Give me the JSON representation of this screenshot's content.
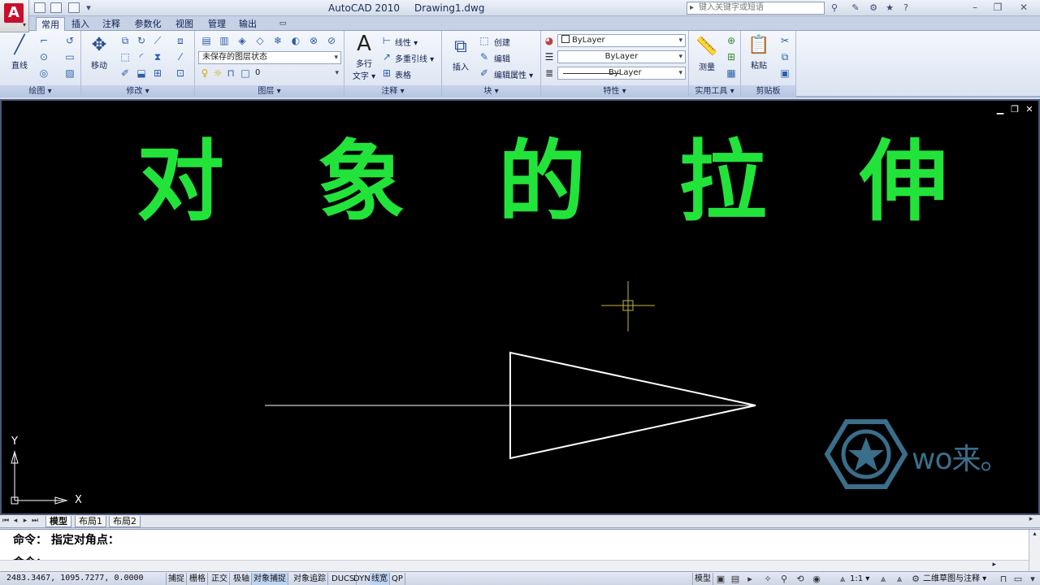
{
  "window": {
    "app": "AutoCAD 2010",
    "doc": "Drawing1.dwg",
    "search_placeholder": "键入关键字或短语"
  },
  "tabs": [
    "常用",
    "插入",
    "注释",
    "参数化",
    "视图",
    "管理",
    "输出"
  ],
  "ribbon": {
    "draw": {
      "title": "绘图 ▾",
      "line": "直线"
    },
    "modify": {
      "title": "修改 ▾",
      "move": "移动"
    },
    "layer": {
      "title": "图层 ▾",
      "state": "未保存的图层状态",
      "current": "0"
    },
    "annotation": {
      "title": "注释 ▾",
      "mtext_1": "多行",
      "mtext_2": "文字 ▾",
      "linear": "线性 ▾",
      "mleader": "多重引线 ▾",
      "table": "表格"
    },
    "block": {
      "title": "块 ▾",
      "insert": "插入",
      "create": "创建",
      "edit": "编辑",
      "edit_attr": "编辑属性 ▾"
    },
    "properties": {
      "title": "特性 ▾",
      "color": "ByLayer",
      "linetype": "ByLayer",
      "lineweight": "ByLayer"
    },
    "utilities": {
      "title": "实用工具 ▾",
      "measure": "测量"
    },
    "clipboard": {
      "title": "剪贴板",
      "paste": "粘贴"
    }
  },
  "canvas": {
    "title_chars": [
      "对",
      "象",
      "的",
      "拉",
      "伸"
    ],
    "axis_x": "X",
    "axis_y": "Y",
    "watermark": "wo来。"
  },
  "layout_tabs": [
    "模型",
    "布局1",
    "布局2"
  ],
  "command": {
    "line1": "命令： 指定对角点：",
    "line2": "命令："
  },
  "status": {
    "coords": "2483.3467, 1095.7277, 0.0000",
    "buttons": [
      {
        "label": "捕捉",
        "on": false
      },
      {
        "label": "栅格",
        "on": false
      },
      {
        "label": "正交",
        "on": false
      },
      {
        "label": "极轴",
        "on": false
      },
      {
        "label": "对象捕捉",
        "on": true
      },
      {
        "label": "对象追踪",
        "on": false
      },
      {
        "label": "DUCS",
        "on": false
      },
      {
        "label": "DYN",
        "on": false
      },
      {
        "label": "线宽",
        "on": true
      },
      {
        "label": "QP",
        "on": false
      }
    ],
    "model": "模型",
    "scale": "1:1 ▾",
    "workspace": "二维草图与注释 ▾"
  },
  "colors": {
    "canvas_bg": "#000000",
    "title_green": "#22e33a",
    "crosshair": "#c8b33a",
    "geometry": "#ffffff"
  }
}
